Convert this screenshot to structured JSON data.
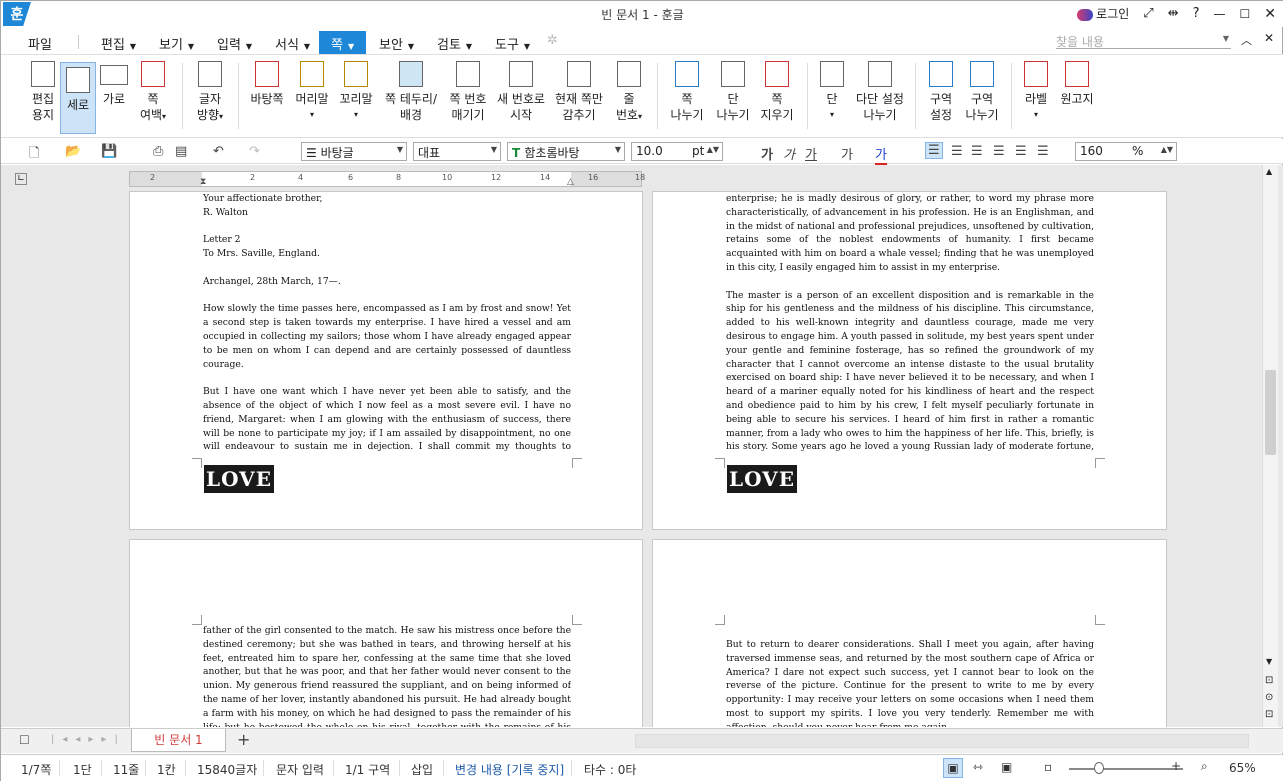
{
  "window": {
    "title": "빈 문서 1 - 훈글",
    "app_logo": "훈",
    "login": "로그인"
  },
  "menu": {
    "file": "파일",
    "items": [
      "편집",
      "보기",
      "입력",
      "서식",
      "쪽",
      "보안",
      "검토",
      "도구"
    ],
    "active": "쪽",
    "search_placeholder": "찾을 내용"
  },
  "ribbon": [
    {
      "id": "edit-paper",
      "label1": "편집",
      "label2": "용지"
    },
    {
      "id": "portrait",
      "label1": "세로",
      "label2": ""
    },
    {
      "id": "landscape",
      "label1": "가로",
      "label2": ""
    },
    {
      "id": "margin",
      "label1": "쪽",
      "label2": "여백"
    },
    {
      "id": "text-dir",
      "label1": "글자",
      "label2": "방향"
    },
    {
      "id": "background",
      "label1": "바탕쪽",
      "label2": ""
    },
    {
      "id": "header",
      "label1": "머리말",
      "label2": ""
    },
    {
      "id": "footer",
      "label1": "꼬리말",
      "label2": ""
    },
    {
      "id": "page-border",
      "label1": "쪽 테두리/",
      "label2": "배경"
    },
    {
      "id": "page-numbering",
      "label1": "쪽 번호",
      "label2": "매기기"
    },
    {
      "id": "new-number",
      "label1": "새 번호로",
      "label2": "시작"
    },
    {
      "id": "hide-page",
      "label1": "현재 쪽만",
      "label2": "감추기"
    },
    {
      "id": "line-number",
      "label1": "줄",
      "label2": "번호"
    },
    {
      "id": "page-break",
      "label1": "쪽",
      "label2": "나누기"
    },
    {
      "id": "column-break",
      "label1": "단",
      "label2": "나누기"
    },
    {
      "id": "page-delete",
      "label1": "쪽",
      "label2": "지우기"
    },
    {
      "id": "columns",
      "label1": "단",
      "label2": ""
    },
    {
      "id": "multi-column",
      "label1": "다단 설정",
      "label2": "나누기"
    },
    {
      "id": "section-setting",
      "label1": "구역",
      "label2": "설정"
    },
    {
      "id": "section-break",
      "label1": "구역",
      "label2": "나누기"
    },
    {
      "id": "label",
      "label1": "라벨",
      "label2": ""
    },
    {
      "id": "manuscript",
      "label1": "원고지",
      "label2": ""
    }
  ],
  "format": {
    "style": "바탕글",
    "lang": "대표",
    "font": "함초롬바탕",
    "size": "10.0",
    "unit": "pt",
    "zoom": "160",
    "zoom_unit": "%",
    "bold": "가",
    "italic": "가",
    "underline": "가",
    "strike": "가",
    "color": "가"
  },
  "ruler": [
    "2",
    "2",
    "4",
    "6",
    "8",
    "10",
    "12",
    "14",
    "16",
    "18"
  ],
  "pages": {
    "p1": "Your affectionate brother,\nR. Walton\n\nLetter 2\nTo Mrs. Saville, England.\n\nArchangel, 28th March, 17—.\n\nHow slowly the time passes here, encompassed as I am by frost and snow! Yet a second step is taken towards my enterprise. I have hired a vessel and am occupied in collecting my sailors; those whom I have already engaged appear to be men on whom I can depend and are certainly possessed of dauntless courage.\n\nBut I have one want which I have never yet been able to satisfy, and the absence of the object of which I now feel as a most severe evil. I have no friend, Margaret: when I am glowing with the enthusiasm of success, there will be none to participate my joy; if I am assailed by disappointment, no one will endeavour to sustain me in dejection. I shall commit my thoughts to paper, it is true; but that is a poor medium for the communication of feeling. I desire the company of a",
    "p2": "enterprise; he is madly desirous of glory, or rather, to word my phrase more characteristically, of advancement in his profession. He is an Englishman, and in the midst of national and professional prejudices, unsoftened by cultivation, retains some of the noblest endowments of humanity. I first became acquainted with him on board a whale vessel; finding that he was unemployed in this city, I easily engaged him to assist in my enterprise.\n\nThe master is a person of an excellent disposition and is remarkable in the ship for his gentleness and the mildness of his discipline. This circumstance, added to his well-known integrity and dauntless courage, made me very desirous to engage him. A youth passed in solitude, my best years spent under your gentle and feminine fosterage, has so refined the groundwork of my character that I cannot overcome an intense distaste to the usual brutality exercised on board ship: I have never believed it to be necessary, and when I heard of a mariner equally noted for his kindliness of heart and the respect and obedience paid to him by his crew, I felt myself peculiarly fortunate in being able to secure his services. I heard of him first in rather a romantic manner, from a lady who owes to him the happiness of her life. This, briefly, is his story. Some years ago he loved a young Russian lady of moderate fortune, and having amassed a considerable sum in prize-money, the",
    "p3": "father of the girl consented to the match. He saw his mistress once before the destined ceremony; but she was bathed in tears, and throwing herself at his feet, entreated him to spare her, confessing at the same time that she loved another, but that he was poor, and that her father would never consent to the union. My generous friend reassured the suppliant, and on being informed of the name of her lover, instantly abandoned his pursuit. He had already bought a farm with his money, on which he had designed to pass the remainder of his life; but he bestowed the whole on his rival, together with the remains of his prize-money to",
    "p4": "But to return to dearer considerations. Shall I meet you again, after having traversed immense seas, and returned by the most southern cape of Africa or America? I dare not expect such success, yet I cannot bear to look on the reverse of the picture. Continue for the present to write to me by every opportunity: I may receive your letters on some occasions when I need them most to support my spirits. I love you very tenderly. Remember me with affection, should you never hear from me again.",
    "love": "LOVE"
  },
  "tabs": {
    "doc": "빈 문서 1",
    "add": "+"
  },
  "status": [
    "1/7쪽",
    "1단",
    "11줄",
    "1칸",
    "15840글자",
    "문자 입력",
    "1/1 구역",
    "삽입",
    "변경 내용 [기록 중지]",
    "타수 : 0타"
  ],
  "zoom_status": "65%",
  "colors": {
    "accent": "#1e87d8",
    "tab_text": "#d23b3b",
    "change_text": "#1e5aa8"
  }
}
